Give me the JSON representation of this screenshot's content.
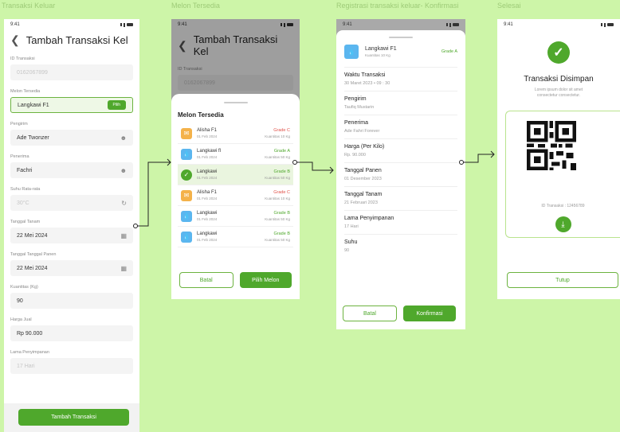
{
  "frames": {
    "f1": "Transaksi Keluar",
    "f2": "Melon Tersedia",
    "f3": "Registrasi transaksi keluar- Konfirmasi",
    "f4": "Selesai"
  },
  "status_time": "9:41",
  "form": {
    "title": "Tambah Transaksi Kel",
    "id_label": "ID Transaksi",
    "id_value": "0162067899",
    "melon_label": "Melon Tersedia",
    "melon_value": "Langkawi F1",
    "pilih": "Pilih",
    "pengirim_label": "Pengirim",
    "pengirim_value": "Ade Twonzer",
    "penerima_label": "Penerima",
    "penerima_value": "Fachri",
    "suhu_label": "Suhu Rata-rata",
    "suhu_value": "30°C",
    "tanam_label": "Tanggal Tanam",
    "tanam_value": "22 Mei 2024",
    "panen_label": "Tanggal Tanggal Panen",
    "panen_value": "22 Mei 2024",
    "kuantitas_label": "Kuantitas (Kg)",
    "kuantitas_value": "90",
    "harga_label": "Harga Jual",
    "harga_value": "Rp 90.000",
    "lama_label": "Lama Penyimpanan",
    "lama_value": "17 Hari",
    "submit": "Tambah Transaksi"
  },
  "melon_sheet": {
    "header_title": "Tambah Transaksi Kel",
    "bg_id_label": "ID Transaksi",
    "bg_id_value": "0162067899",
    "title": "Melon Tersedia",
    "items": [
      {
        "name": "Alisha F1",
        "date": "01 Feb 2024",
        "grade": "Grade C",
        "qty": "Kuantitas 10 Kg",
        "color": "#f4b24a",
        "grade_color": "#e0524a"
      },
      {
        "name": "Langkawi fl",
        "date": "01 Feb 2024",
        "grade": "Grade A",
        "qty": "Kuantitas 50 Kg",
        "color": "#5bb6ef",
        "grade_color": "#4fa82c"
      },
      {
        "name": "Langkawi",
        "date": "01 Feb 2024",
        "grade": "Grade B",
        "qty": "Kuantitas 50 Kg",
        "color": "#4fa82c",
        "grade_color": "#4fa82c"
      },
      {
        "name": "Alisha F1",
        "date": "01 Feb 2024",
        "grade": "Grade C",
        "qty": "Kuantitas 10 Kg",
        "color": "#f4b24a",
        "grade_color": "#e0524a"
      },
      {
        "name": "Langkawi",
        "date": "01 Feb 2024",
        "grade": "Grade B",
        "qty": "Kuantitas 50 Kg",
        "color": "#5bb6ef",
        "grade_color": "#4fa82c"
      },
      {
        "name": "Langkawi",
        "date": "01 Feb 2024",
        "grade": "Grade B",
        "qty": "Kuantitas 50 Kg",
        "color": "#5bb6ef",
        "grade_color": "#4fa82c"
      }
    ],
    "cancel": "Batal",
    "choose": "Pilih Melon"
  },
  "confirm": {
    "product_name": "Langkawi F1",
    "product_qty": "Kuantitas 10 Kg",
    "product_grade": "Grade A",
    "rows": [
      {
        "label": "Waktu Transaksi",
        "value": "30 Maret 2023 • 09 : 30"
      },
      {
        "label": "Pengirim",
        "value": "Taufiq Mustarin"
      },
      {
        "label": "Penerima",
        "value": "Ade Fahri Forever"
      },
      {
        "label": "Harga (Per Kilo)",
        "value": "Rp. 90.000"
      },
      {
        "label": "Tanggal Panen",
        "value": "01 Desember 2023"
      },
      {
        "label": "Tanggal Tanam",
        "value": "21 Februari 2023"
      },
      {
        "label": "Lama Penyimpanan",
        "value": "17 Hari"
      },
      {
        "label": "Suhu",
        "value": "90"
      }
    ],
    "cancel": "Batal",
    "confirm": "Konfirmasi"
  },
  "done": {
    "title": "Transaksi Disimpan",
    "subtitle": "Lorem ipsum dolor sit amet consectetur consectetur.",
    "id_text": "ID Transaksi : 12456789",
    "close": "Tutup"
  },
  "colors": {
    "background": "#cdf5a8",
    "primary": "#4fa82c",
    "grade_c": "#e0524a"
  }
}
